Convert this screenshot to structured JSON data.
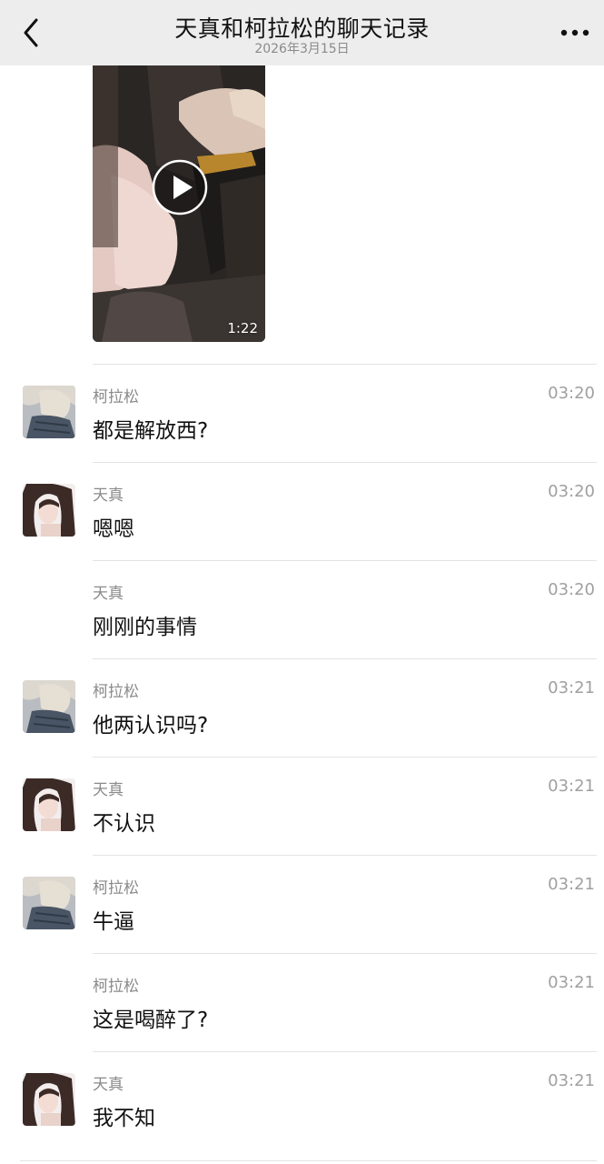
{
  "header": {
    "title": "天真和柯拉松的聊天记录",
    "date": "2026年3月15日",
    "back_icon": "chevron-left-icon",
    "more_icon": "more-dots-icon"
  },
  "video": {
    "duration": "1:22",
    "play_icon": "play-icon"
  },
  "messages": [
    {
      "sender": "柯拉松",
      "time": "03:20",
      "text": "都是解放西?",
      "avatar": "koraso"
    },
    {
      "sender": "天真",
      "time": "03:20",
      "text": "嗯嗯",
      "avatar": "tianzhen"
    },
    {
      "sender": "天真",
      "time": "03:20",
      "text": "刚刚的事情",
      "avatar": ""
    },
    {
      "sender": "柯拉松",
      "time": "03:21",
      "text": "他两认识吗?",
      "avatar": "koraso"
    },
    {
      "sender": "天真",
      "time": "03:21",
      "text": "不认识",
      "avatar": "tianzhen"
    },
    {
      "sender": "柯拉松",
      "time": "03:21",
      "text": "牛逼",
      "avatar": "koraso"
    },
    {
      "sender": "柯拉松",
      "time": "03:21",
      "text": "这是喝醉了?",
      "avatar": ""
    },
    {
      "sender": "天真",
      "time": "03:21",
      "text": "我不知",
      "avatar": "tianzhen"
    }
  ]
}
